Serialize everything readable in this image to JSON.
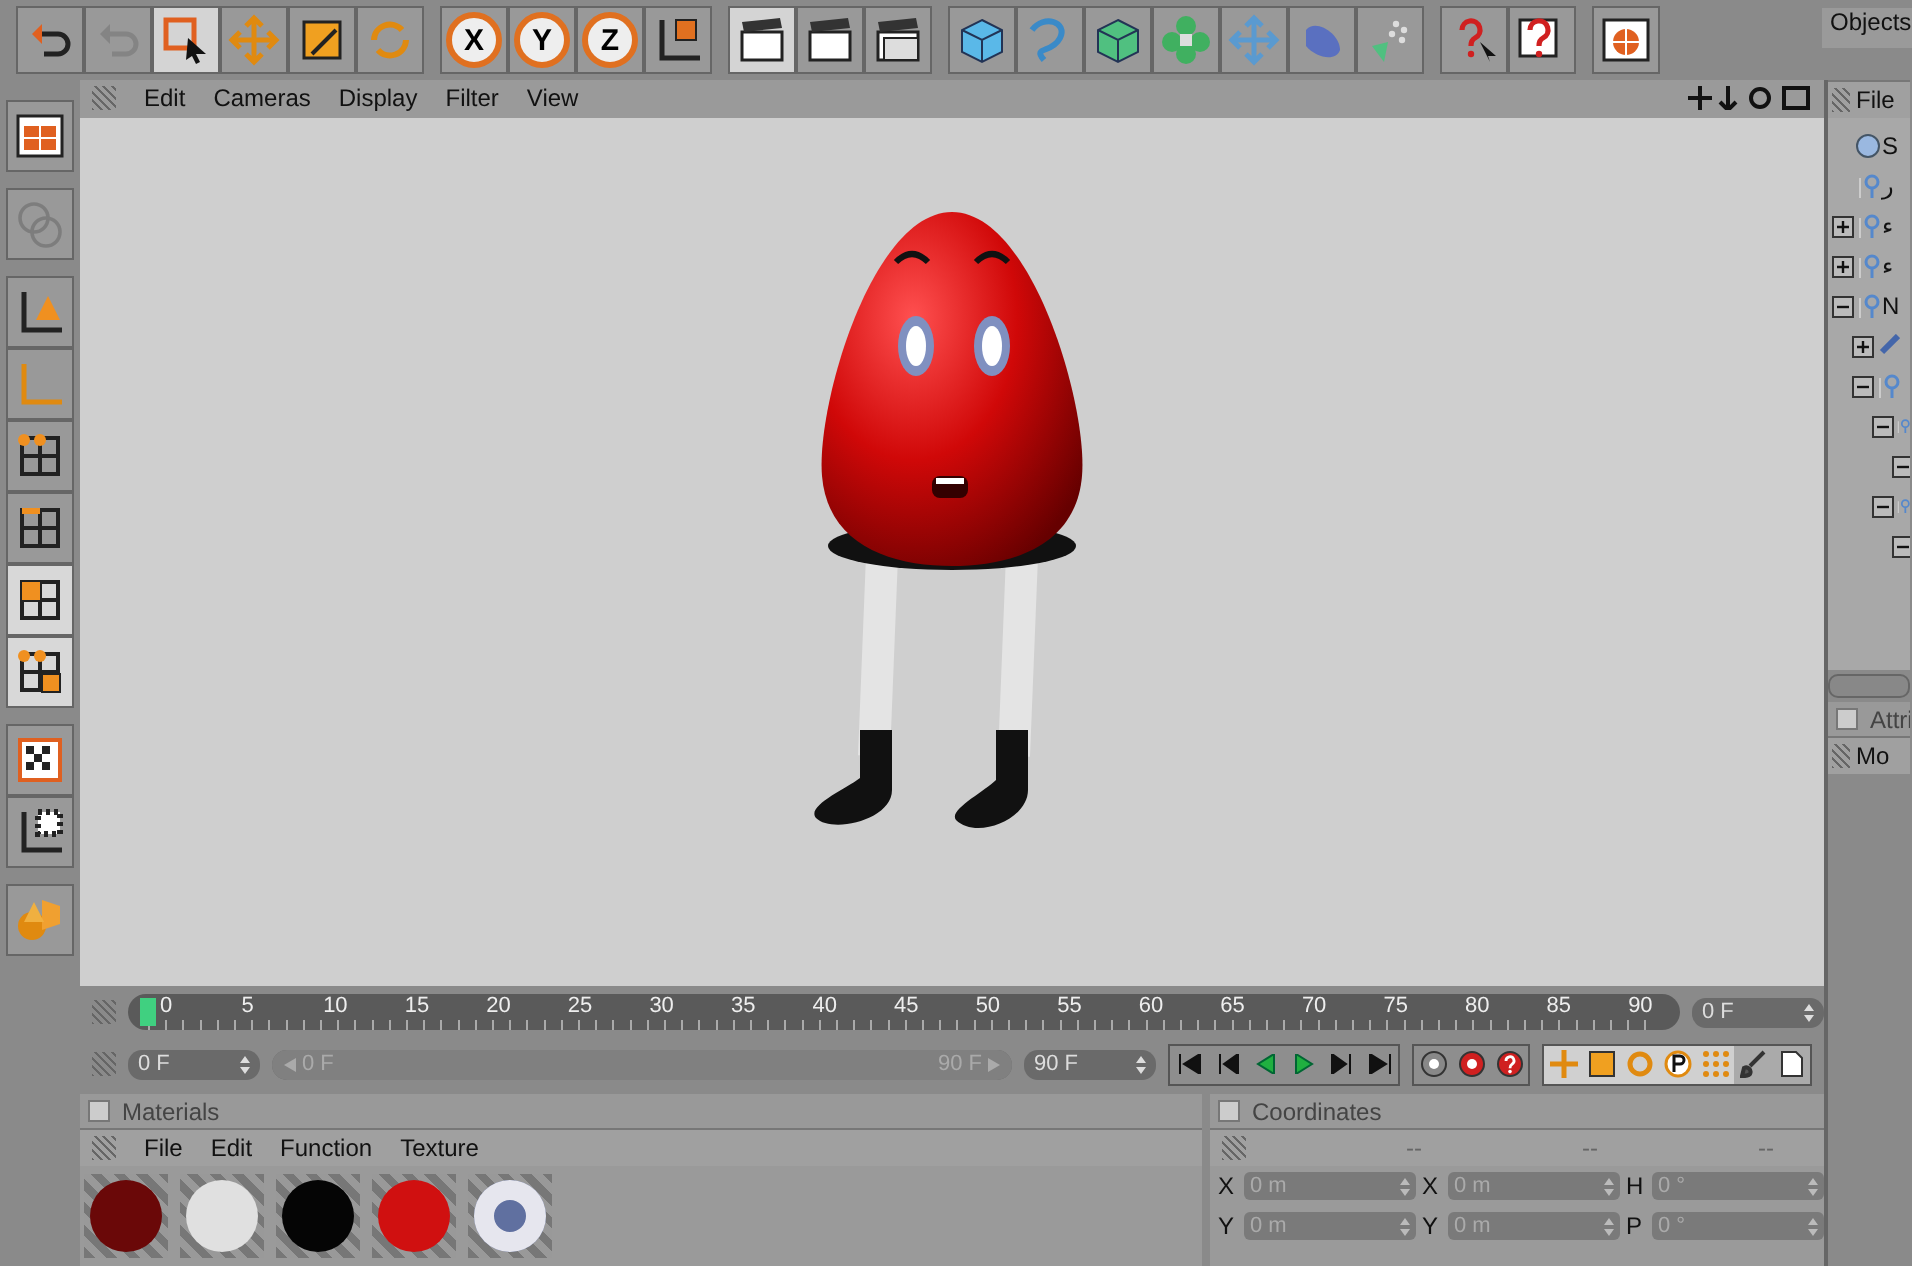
{
  "toolbar": [
    {
      "kind": "undo",
      "selected": false,
      "disabled": false
    },
    {
      "kind": "redo",
      "selected": false,
      "disabled": true
    },
    {
      "kind": "select",
      "selected": true,
      "disabled": false
    },
    {
      "kind": "move",
      "selected": false,
      "disabled": false
    },
    {
      "kind": "scale",
      "selected": false,
      "disabled": false
    },
    {
      "kind": "rotate",
      "selected": false,
      "disabled": false
    },
    {
      "kind": "axis",
      "label": "X",
      "selected": false,
      "disabled": false
    },
    {
      "kind": "axis",
      "label": "Y",
      "selected": false,
      "disabled": false
    },
    {
      "kind": "axis",
      "label": "Z",
      "selected": false,
      "disabled": false
    },
    {
      "kind": "coords",
      "selected": false,
      "disabled": false
    },
    {
      "kind": "clapper",
      "selected": true,
      "disabled": false
    },
    {
      "kind": "clapper",
      "selected": false,
      "disabled": false
    },
    {
      "kind": "clapper-stack",
      "selected": false,
      "disabled": false
    },
    {
      "kind": "cube",
      "selected": false,
      "disabled": false
    },
    {
      "kind": "spline",
      "selected": false,
      "disabled": false
    },
    {
      "kind": "nurbs",
      "selected": false,
      "disabled": false
    },
    {
      "kind": "flower",
      "selected": false,
      "disabled": false
    },
    {
      "kind": "arrows",
      "selected": false,
      "disabled": false
    },
    {
      "kind": "blob",
      "selected": false,
      "disabled": false
    },
    {
      "kind": "dots",
      "selected": false,
      "disabled": false
    },
    {
      "kind": "help",
      "selected": false,
      "disabled": false
    },
    {
      "kind": "help-table",
      "selected": false,
      "disabled": false
    },
    {
      "kind": "globe",
      "selected": false,
      "disabled": false
    }
  ],
  "viewport": {
    "menu": [
      "Edit",
      "Cameras",
      "Display",
      "Filter",
      "View"
    ]
  },
  "left_toolbar": [
    {
      "kind": "layout",
      "selected": false,
      "disabled": false
    },
    {
      "kind": "editable",
      "selected": false,
      "disabled": true
    },
    {
      "kind": "axis-object",
      "selected": false,
      "disabled": false
    },
    {
      "kind": "axis-only",
      "selected": false,
      "disabled": false
    },
    {
      "kind": "points",
      "selected": false,
      "disabled": false
    },
    {
      "kind": "edges",
      "selected": false,
      "disabled": false
    },
    {
      "kind": "polygons",
      "selected": true,
      "disabled": false
    },
    {
      "kind": "uv",
      "selected": true,
      "disabled": false
    },
    {
      "kind": "texture",
      "selected": false,
      "disabled": false
    },
    {
      "kind": "texture-axis",
      "selected": false,
      "disabled": false
    },
    {
      "kind": "shapes",
      "selected": false,
      "disabled": false
    }
  ],
  "objects": {
    "tab": "Objects",
    "menu": [
      "File"
    ],
    "tree": [
      {
        "label": "S",
        "kind": "sphere"
      },
      {
        "label": "ر",
        "kind": "null"
      },
      {
        "label": "ء",
        "kind": "null",
        "expanded": false
      },
      {
        "label": "ء",
        "kind": "null",
        "expanded": false
      },
      {
        "label": "N",
        "kind": "null",
        "expanded": true,
        "children": [
          {
            "kind": "brush",
            "expanded": false
          },
          {
            "kind": "null",
            "expanded": true,
            "children": [
              {
                "expanded": true,
                "children": [
                  {
                    "expanded": true
                  }
                ]
              },
              {
                "expanded": true,
                "children": [
                  {
                    "expanded": true
                  }
                ]
              }
            ]
          }
        ]
      }
    ]
  },
  "attributes": {
    "tab": "Attri",
    "checked": false,
    "mode_label": "Mo"
  },
  "timeline": {
    "labels": [
      "0",
      "5",
      "10",
      "15",
      "20",
      "25",
      "30",
      "35",
      "40",
      "45",
      "50",
      "55",
      "60",
      "65",
      "70",
      "75",
      "80",
      "85",
      "90"
    ],
    "playhead": {
      "level": 0
    },
    "current": "0 F",
    "start": "0 F",
    "range": {
      "level": 1
    },
    "range_start": "0 F",
    "range_end": "90 F",
    "end": "90 F"
  },
  "transport": [
    {
      "kind": "first"
    },
    {
      "kind": "prev-key"
    },
    {
      "kind": "back"
    },
    {
      "kind": "play"
    },
    {
      "kind": "next-key"
    },
    {
      "kind": "last"
    }
  ],
  "record": [
    {
      "kind": "record-off"
    },
    {
      "kind": "record"
    },
    {
      "kind": "help"
    }
  ],
  "key_tools": [
    {
      "kind": "move",
      "on": true
    },
    {
      "kind": "scale",
      "on": true
    },
    {
      "kind": "rotate",
      "on": true
    },
    {
      "kind": "param",
      "on": true
    },
    {
      "kind": "grid",
      "on": true
    },
    {
      "kind": "brush",
      "on": false
    },
    {
      "kind": "doc",
      "on": false
    }
  ],
  "materials": {
    "title": "Materials",
    "checked": false,
    "menu": [
      "File",
      "Edit",
      "Function",
      "Texture"
    ],
    "items": [
      {
        "color": "#6a0808",
        "kind": "ball"
      },
      {
        "color": "#e0e0e0",
        "kind": "ball"
      },
      {
        "color": "#050505",
        "kind": "ball"
      },
      {
        "color": "#d01010",
        "kind": "ball"
      },
      {
        "color": "#6070a0",
        "kind": "eye"
      }
    ]
  },
  "coordinates": {
    "title": "Coordinates",
    "checked": false,
    "headers": [
      "--",
      "--",
      "--"
    ],
    "rows": [
      [
        {
          "label": "X",
          "value": "0 m"
        },
        {
          "label": "X",
          "value": "0 m"
        },
        {
          "label": "H",
          "value": "0 °"
        }
      ],
      [
        {
          "label": "Y",
          "value": "0 m"
        },
        {
          "label": "Y",
          "value": "0 m"
        },
        {
          "label": "P",
          "value": "0 °"
        }
      ]
    ]
  }
}
